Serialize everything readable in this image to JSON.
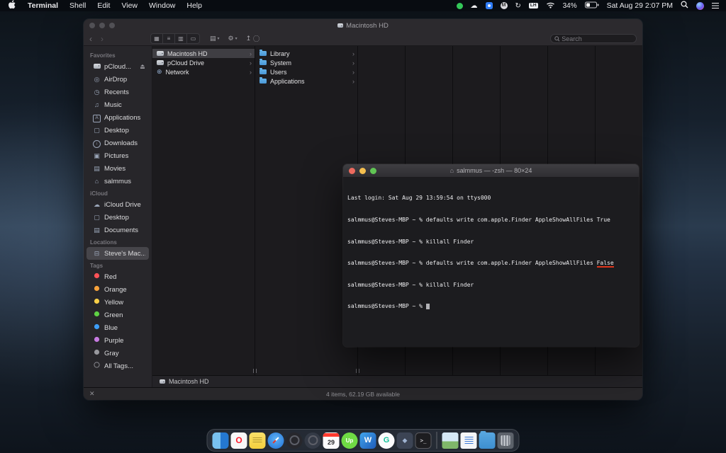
{
  "colors": {
    "annotation": "#e0351b",
    "folder_blue": "#58a7e0",
    "tags": {
      "red": "#ff5257",
      "orange": "#f7a23b",
      "yellow": "#f8ce47",
      "green": "#5fd144",
      "blue": "#3d9df6",
      "purple": "#c77ae0",
      "gray": "#98989d"
    }
  },
  "menu_bar": {
    "app_name": "Terminal",
    "menus": {
      "shell": "Shell",
      "edit": "Edit",
      "view": "View",
      "window": "Window",
      "help": "Help"
    },
    "status": {
      "lh": "LH",
      "battery": "34%",
      "clock": "Sat Aug 29 2:07 PM"
    }
  },
  "finder": {
    "title": "Macintosh HD",
    "toolbar": {
      "search_placeholder": "Search"
    },
    "sidebar": {
      "favorites_title": "Favorites",
      "favorites": {
        "pcloud": "pCloud...",
        "airdrop": "AirDrop",
        "recents": "Recents",
        "music": "Music",
        "applications": "Applications",
        "desktop": "Desktop",
        "downloads": "Downloads",
        "pictures": "Pictures",
        "movies": "Movies",
        "home": "salmmus"
      },
      "icloud_title": "iCloud",
      "icloud": {
        "drive": "iCloud Drive",
        "desktop": "Desktop",
        "documents": "Documents"
      },
      "locations_title": "Locations",
      "locations": {
        "mac": "Steve's Mac..."
      },
      "tags_title": "Tags",
      "tags": {
        "red": "Red",
        "orange": "Orange",
        "yellow": "Yellow",
        "green": "Green",
        "blue": "Blue",
        "purple": "Purple",
        "gray": "Gray",
        "all": "All Tags..."
      }
    },
    "columns": {
      "col1": {
        "macintosh_hd": "Macintosh HD",
        "pcloud_drive": "pCloud Drive",
        "network": "Network"
      },
      "col2": {
        "library": "Library",
        "system": "System",
        "users": "Users",
        "applications": "Applications"
      }
    },
    "path_bar": "Macintosh HD",
    "status_bar": "4 items, 62.19 GB available",
    "status_close": "✕"
  },
  "terminal": {
    "title": "salmmus — -zsh — 80×24",
    "line1": "Last login: Sat Aug 29 13:59:54 on ttys000",
    "line2": "salmmus@Steves-MBP ~ % defaults write com.apple.Finder AppleShowAllFiles True",
    "line3": "salmmus@Steves-MBP ~ % killall Finder",
    "line4_prefix": "salmmus@Steves-MBP ~ % defaults write com.apple.Finder AppleShowAllFiles ",
    "line4_highlight": "False",
    "line5": "salmmus@Steves-MBP ~ % killall Finder",
    "prompt": "salmmus@Steves-MBP ~ % "
  },
  "dock": {
    "opera": "O",
    "calendar_day": "29",
    "upwork": "Up",
    "word": "W",
    "grammarly": "G",
    "terminal_glyph": ">_"
  }
}
